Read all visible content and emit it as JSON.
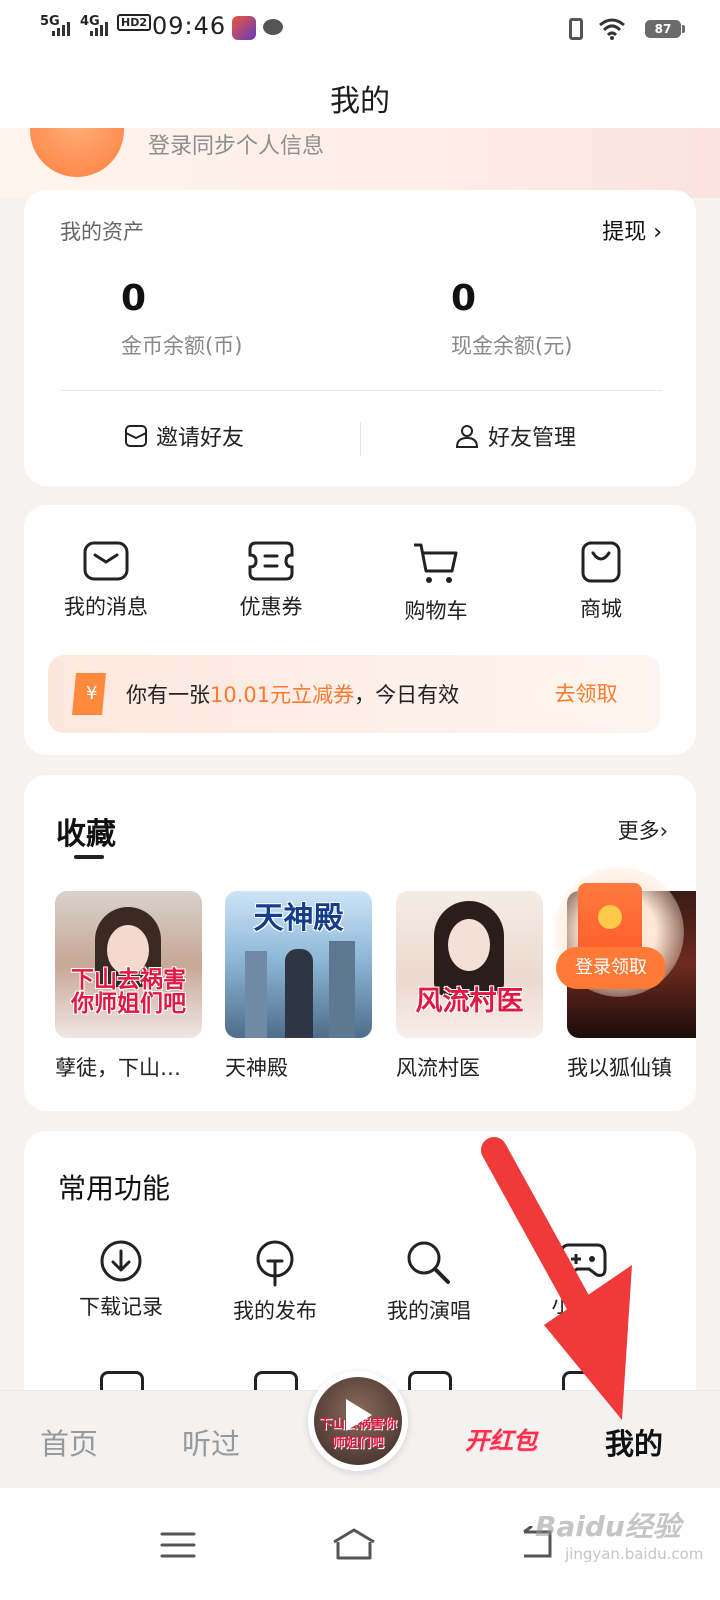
{
  "status_bar": {
    "network1": "5G",
    "network2": "4G",
    "hd": "HD2",
    "time": "09:46",
    "battery": "87"
  },
  "header": {
    "title": "我的"
  },
  "profile": {
    "login_hint": "登录同步个人信息"
  },
  "assets": {
    "title": "我的资产",
    "withdraw_label": "提现 ›",
    "coins_value": "0",
    "coins_label": "金币余额(币)",
    "cash_value": "0",
    "cash_label": "现金余额(元)",
    "invite_label": "邀请好友",
    "friends_label": "好友管理"
  },
  "quick": {
    "items": [
      {
        "label": "我的消息",
        "icon": "envelope-icon"
      },
      {
        "label": "优惠券",
        "icon": "ticket-icon"
      },
      {
        "label": "购物车",
        "icon": "cart-icon"
      },
      {
        "label": "商城",
        "icon": "shopping-bag-icon"
      }
    ],
    "coupon_prefix": "你有一张",
    "coupon_highlight": "10.01元立减券",
    "coupon_suffix": "，今日有效",
    "coupon_button": "去领取"
  },
  "favorites": {
    "title": "收藏",
    "more": "更多›",
    "books": [
      {
        "name": "孽徒，下山…",
        "cover_text": "下山去祸害你师姐们吧"
      },
      {
        "name": "天神殿",
        "cover_text": "天神殿"
      },
      {
        "name": "风流村医",
        "cover_text": "风流村医"
      },
      {
        "name": "我以狐仙镇",
        "cover_text": ""
      }
    ],
    "red_packet_label": "登录领取"
  },
  "functions": {
    "title": "常用功能",
    "items": [
      {
        "label": "下载记录",
        "icon": "download-icon"
      },
      {
        "label": "我的发布",
        "icon": "bulb-icon"
      },
      {
        "label": "我的演唱",
        "icon": "search-mic-icon"
      },
      {
        "label": "小游戏",
        "icon": "gamepad-icon"
      }
    ]
  },
  "bottom_nav": {
    "home": "首页",
    "listened": "听过",
    "player_cover_text": "下山去祸害你师姐们吧",
    "red_envelope": "开红包",
    "mine": "我的"
  },
  "watermark": {
    "brand": "Baidu经验",
    "url": "jingyan.baidu.com"
  },
  "colors": {
    "accent": "#ff7a2e",
    "arrow": "#f03a3a",
    "page_bg": "#f6f2ef"
  }
}
